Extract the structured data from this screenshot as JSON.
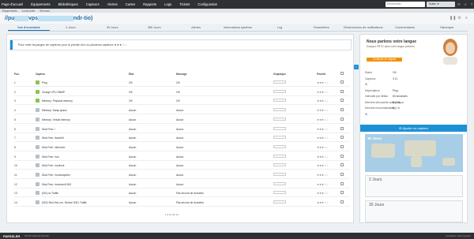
{
  "nav": {
    "menu": [
      "Page d'accueil",
      "Équipements",
      "Bibliothèques",
      "Capteurs",
      "Alertes",
      "Cartes",
      "Rapports",
      "Logs",
      "Tickets",
      "Configuration"
    ],
    "search_placeholder": "Rechercher...",
    "filter_label": "Toutes ▼"
  },
  "sub_breadcrumb": [
    "Équipements",
    "Local probe",
    "Serveurs"
  ],
  "page": {
    "title_prefix": "//pu",
    "title_highlight": "",
    "title_suffix": "vps",
    "title_hidden": "",
    "title_end": "ndr-tio)"
  },
  "tabs": [
    "Vue d'ensemble",
    "2 Jours",
    "30 Jours",
    "365 Jours",
    "Alertes",
    "Informations système",
    "Log",
    "Paramètres",
    "Déclencheurs de notifications",
    "Commentaires",
    "Historique"
  ],
  "info_text": "Pour noter les jauges de capteurs pour la priorité d'un ou plusieurs capteurs ★★★☆☆",
  "table": {
    "headers": [
      "Pos.",
      "Capteur",
      "État",
      "Message",
      "Graphique",
      "Priorité"
    ],
    "rows": [
      {
        "pos": "1",
        "name": "Ping",
        "state": "OK",
        "msg": "OK",
        "color": "#8bc34a"
      },
      {
        "pos": "2",
        "name": "Charge CPU SNMP",
        "state": "OK",
        "msg": "OK",
        "color": "#8bc34a"
      },
      {
        "pos": "3",
        "name": "Memory: Physical memory",
        "state": "OK",
        "msg": "OK",
        "color": "#8bc34a"
      },
      {
        "pos": "4",
        "name": "Memory: Swap space",
        "state": "Aucun",
        "msg": "Aucun",
        "color": "#b8bfc6"
      },
      {
        "pos": "5",
        "name": "Memory: Virtual memory",
        "state": "Aucun",
        "msg": "Aucun",
        "color": "#b8bfc6"
      },
      {
        "pos": "6",
        "name": "Disk Free: /",
        "state": "Aucun",
        "msg": "Aucun",
        "color": "#b8bfc6"
      },
      {
        "pos": "7",
        "name": "Disk Free: /boot/efi",
        "state": "Aucun",
        "msg": "Aucun",
        "color": "#b8bfc6"
      },
      {
        "pos": "8",
        "name": "Disk Free: /dev/shm",
        "state": "Aucun",
        "msg": "Aucun",
        "color": "#b8bfc6"
      },
      {
        "pos": "9",
        "name": "Disk Free: /run",
        "state": "Aucun",
        "msg": "Aucun",
        "color": "#b8bfc6"
      },
      {
        "pos": "10",
        "name": "Disk Free: /run/lock",
        "state": "Aucun",
        "msg": "Aucun",
        "color": "#b8bfc6"
      },
      {
        "pos": "11",
        "name": "Disk Free: /run/snapd/ns",
        "state": "Aucun",
        "msg": "Aucun",
        "color": "#b8bfc6"
      },
      {
        "pos": "12",
        "name": "Disk Free: /run/user/1000",
        "state": "Aucun",
        "msg": "Aucun",
        "color": "#b8bfc6"
      },
      {
        "pos": "13",
        "name": "(001) lo Traffic",
        "state": "Aucun",
        "msg": "Pas encore de données",
        "color": "#b8bfc6"
      },
      {
        "pos": "14",
        "name": "(002) Red Hat, Inc. Device 0001 Traffic",
        "state": "Aucun",
        "msg": "Pas encore de données",
        "color": "#b8bfc6"
      }
    ],
    "stars": "★★★☆☆",
    "pager": "1 à 14 de 14"
  },
  "promo": {
    "title": "Nous parlons votre langue",
    "text": "Essayez PRTG dans votre langue préférée",
    "button": "Continuer en anglais"
  },
  "status": {
    "rows": [
      {
        "k": "Statut",
        "v": "OK"
      },
      {
        "k": "Capteurs",
        "v": "3  11"
      },
      {
        "k": "ID",
        "v": ""
      },
      {
        "k": "Dépendance",
        "v": "Ping"
      },
      {
        "k": "Intervalle par défaut",
        "v": "60 secondes"
      },
      {
        "k": "Dernière découverte automatique",
        "v": "8 j 1 h"
      },
      {
        "k": "Dernière recommandation",
        "v": "8 j 1 h"
      },
      {
        "k": "ID",
        "v": ""
      }
    ],
    "add_sensor": "Ajouter un capteur"
  },
  "panel": {
    "map_label": "30 Jours",
    "chart1": "2 Jours",
    "chart2": "30 Jours"
  },
  "footer": {
    "brand": "PAESSLER",
    "info": "PRTG Network Monitor",
    "right": "Contacter notre support"
  }
}
